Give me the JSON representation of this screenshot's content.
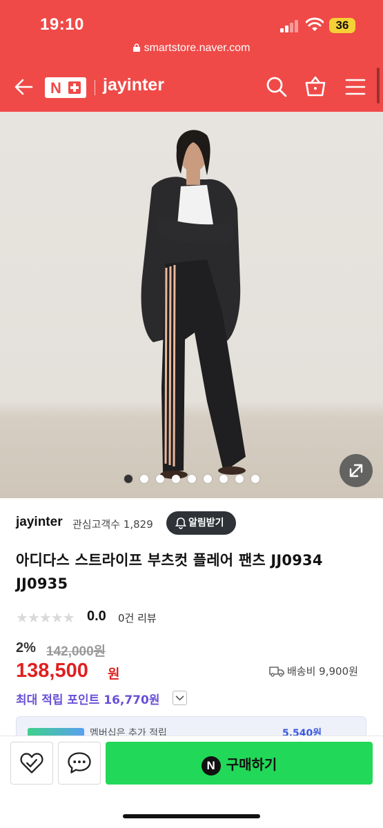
{
  "status_bar": {
    "time": "19:10",
    "battery": "36"
  },
  "browser": {
    "url": "smartstore.naver.com"
  },
  "nav": {
    "logo": "N",
    "store_title": "jayinter"
  },
  "gallery": {
    "total": 9,
    "active_index": 0
  },
  "store": {
    "name": "jayinter",
    "followers_label": "관심고객수",
    "followers_count": "1,829",
    "notify_label": "알림받기"
  },
  "product": {
    "title": "아디다스 스트라이프 부츠컷 플레어 팬츠 JJ0934 JJ0935",
    "stars": "★★★★★",
    "rating": "0.0",
    "reviews": "0건 리뷰",
    "discount": "2%",
    "original_price": "142,000원",
    "price": "138,500",
    "price_unit": "원",
    "shipping": "배송비 9,900원",
    "points": "최대 적립 포인트 16,770원"
  },
  "membership": {
    "text": "멤버십은 추가 적립",
    "right": "5,540원"
  },
  "actions": {
    "buy_label": "구매하기",
    "npay_label": "N"
  },
  "colors": {
    "brand_red": "#ef4a48",
    "buy_green": "#22d858",
    "price_red": "#e02020",
    "points_purple": "#6a4fd6"
  }
}
